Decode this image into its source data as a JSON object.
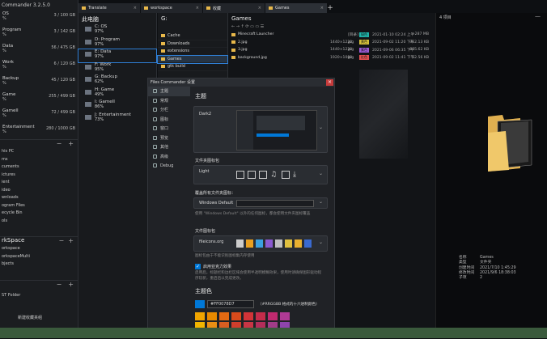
{
  "app": {
    "title": "Commander 3.2.5.0"
  },
  "sidebar": {
    "drives": [
      {
        "name": "OS",
        "size": "3 / 100 GB",
        "pct": "%"
      },
      {
        "name": "Program",
        "size": "3 / 142 GB",
        "pct": "%"
      },
      {
        "name": "Data",
        "size": "56 / 475 GB",
        "pct": "%"
      },
      {
        "name": "Work",
        "size": "6 / 120 GB",
        "pct": "%"
      },
      {
        "name": "Backup",
        "size": "45 / 120 GB",
        "pct": "%"
      },
      {
        "name": "Game",
        "size": "255 / 499 GB",
        "pct": "%"
      },
      {
        "name": "GameII",
        "size": "72 / 499 GB",
        "pct": "%"
      },
      {
        "name": "Entertainment",
        "size": "280 / 1000 GB",
        "pct": "%"
      }
    ],
    "quick": [
      "his PC",
      "ms",
      "cuments",
      "ictures",
      "ient",
      "ideo",
      "wnloads",
      "ogram Files",
      "ecycle Bin",
      "ols"
    ],
    "workspace_title": "rkSpace",
    "workspace": [
      "orkspace",
      "orkspaceMulti",
      "bjects"
    ],
    "bottom": [
      "ST Folder",
      "新建收藏夹组"
    ]
  },
  "tabs": [
    {
      "label": "Translate"
    },
    {
      "label": "workspace"
    },
    {
      "label": "收藏"
    },
    {
      "label": "Games"
    }
  ],
  "pane1": {
    "title": "此电脑",
    "drives": [
      {
        "name": "C: OS",
        "pct": "97%"
      },
      {
        "name": "D: Program",
        "pct": "97%"
      },
      {
        "name": "E: Data",
        "pct": "97%"
      },
      {
        "name": "F: Work",
        "pct": "95%"
      },
      {
        "name": "G: Backup",
        "pct": "62%"
      },
      {
        "name": "H: Game",
        "pct": "49%"
      },
      {
        "name": "I: GameII",
        "pct": "86%"
      },
      {
        "name": "J: Entertainment",
        "pct": "73%"
      }
    ]
  },
  "pane2": {
    "title": "G:",
    "folders": [
      "Cache",
      "Downloads",
      "extensions",
      "Games",
      "gtk build"
    ]
  },
  "pane3": {
    "title": "Games",
    "nav": "← → ↑ ⟳ ▭ ▭ ☰",
    "rows": [
      {
        "name": "Minecraft Launcher",
        "dim": "",
        "type": "[目录]",
        "tag": "绿色",
        "tagcolor": "#1fb3a8",
        "date": "2021-01-10 02:24 上午",
        "size": "~287 MB"
      },
      {
        "name": "2.jpg",
        "dim": "1440×1220",
        "type": "jpg",
        "tag": "黄色",
        "tagcolor": "#d4c03a",
        "date": "2021-09-02 11:20 下午",
        "size": "312.13 KB"
      },
      {
        "name": "3.jpg",
        "dim": "1440×1220",
        "type": "jpg",
        "tag": "紫色",
        "tagcolor": "#9c5bd6",
        "date": "2021-09-06 06:35 下午",
        "size": "605.62 KB"
      },
      {
        "name": "background.jpg",
        "dim": "1920×1080",
        "type": "jpg",
        "tag": "红色",
        "tagcolor": "#e05050",
        "date": "2021-09-02 11:41 下午",
        "size": "52.56 KB"
      }
    ]
  },
  "details": {
    "count": "4 项目",
    "props": [
      {
        "k": "名称",
        "v": "Games"
      },
      {
        "k": "类型",
        "v": "文件夹"
      },
      {
        "k": "创建时间",
        "v": "2021/7/10 1:45:29"
      },
      {
        "k": "修改时间",
        "v": "2021/9/6 18:38:03"
      },
      {
        "k": "子项",
        "v": "2"
      }
    ]
  },
  "dialog": {
    "title": "Files Commander 设置",
    "close": "×",
    "nav": [
      "主题",
      "常规",
      "分栏",
      "图标",
      "窗口",
      "预览",
      "其他",
      "高级",
      "Debug"
    ],
    "heading": "主题",
    "theme_name": "Dark2",
    "folder_icons_label": "文件夹图标包",
    "folder_icons_value": "Light",
    "override_label": "覆盖所有文件夹图标：",
    "override_value": "Windows Default",
    "override_note": "使用 \"Windows Default\" 以外的任何图标，都会使用文件夹图标覆盖",
    "file_icons_label": "文件图标包",
    "file_icons_value": "fileicons.org",
    "file_icons_note": "图标包由于不能识别图标集内存使用",
    "acrylic_label": "启用亚克力效果",
    "acrylic_note": "启用后，标题栏和边栏区域会使用半透明模糊效果，使用时请确保图形驱动程序较新，重启后以完成更改。",
    "color_heading": "主题色",
    "color_value": "#FF0078D7",
    "color_hint": "（#RRGGBB 格式的十六进制颜色）",
    "accent": "#0078D7",
    "palette": [
      "#f0a500",
      "#e88a00",
      "#e36a12",
      "#d84a1b",
      "#d13438",
      "#c42c4a",
      "#bf2a6f",
      "#b03a95",
      "#f2b500",
      "#ea8f14",
      "#d95e21",
      "#cf3e2c",
      "#c93545",
      "#b32d5a",
      "#a23c88",
      "#8e44ad"
    ]
  }
}
